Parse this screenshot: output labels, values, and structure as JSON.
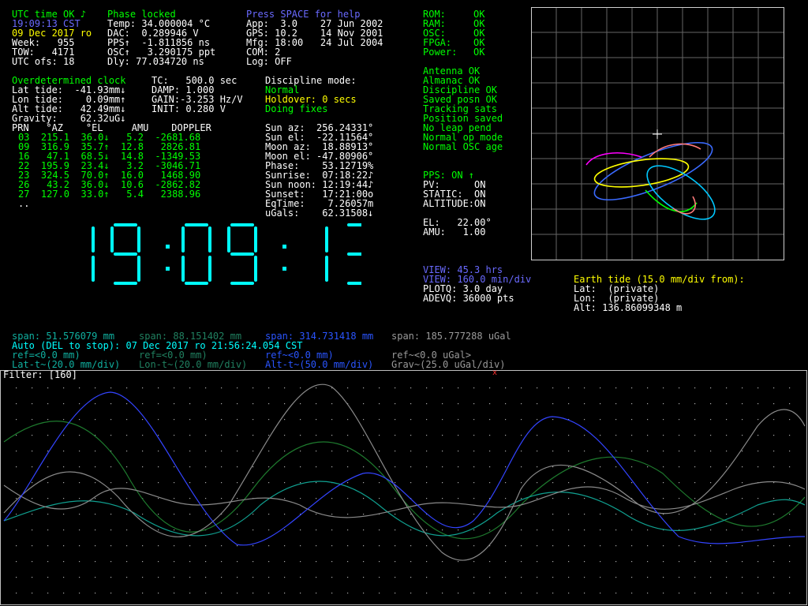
{
  "status": {
    "utc_time_ok": "UTC time OK ♪",
    "phase": "Phase locked",
    "time": "19:09:13 CST",
    "date": "09 Dec 2017 ro",
    "week": "Week:   955",
    "tow": "TOW:   4171",
    "utc_ofs": "UTC ofs: 18"
  },
  "receiver": {
    "temp": "Temp: 34.000004 °C",
    "dac": "DAC:  0.289946 V",
    "pps": "PPS↑  -1.811856 ns",
    "osc": "OSC↑   3.290175 ppt",
    "dly": "Dly: 77.034720 ns"
  },
  "version": {
    "help": "Press SPACE for help",
    "app": "App:  3.0    27 Jun 2002",
    "gps": "GPS: 10.2    14 Nov 2001",
    "mfg": "Mfg: 18:00   24 Jul 2004",
    "com": "COM: 2",
    "log": "Log: OFF"
  },
  "health": [
    {
      "name": "ROM:",
      "value": "OK"
    },
    {
      "name": "RAM:",
      "value": "OK"
    },
    {
      "name": "OSC:",
      "value": "OK"
    },
    {
      "name": "FPGA:",
      "value": "OK"
    },
    {
      "name": "Power:",
      "value": "OK"
    }
  ],
  "clock": {
    "title": "Overdetermined clock",
    "lat_tide": "Lat tide:  -41.93mm↓",
    "lon_tide": "Lon tide:    0.09mm↑",
    "alt_tide": "Alt tide:   42.49mm↓",
    "gravity": "Gravity:    62.32uG↓",
    "tc": "TC:   500.0 sec",
    "damp": "DAMP: 1.000",
    "gain": "GAIN:-3.253 Hz/V",
    "init": "INIT: 0.280 V"
  },
  "discipline": {
    "title": "Discipline mode:",
    "mode": "Normal",
    "holdover": "Holdover: 0 secs",
    "doing": "Doing fixes"
  },
  "status_list": [
    "Antenna OK",
    "Almanac OK",
    "Discipline OK",
    "Saved posn OK",
    "Tracking sats",
    "Position saved",
    "No leap pend",
    "Normal op mode",
    "Normal OSC age"
  ],
  "sats": {
    "header": "PRN   °AZ    °EL     AMU    DOPPLER",
    "rows": [
      "03  215.1  36.0↓   5.2  -2681.68",
      "09  316.9  35.7↑  12.8   2826.81",
      "16   47.1  68.5↓  14.8  -1349.53",
      "22  195.9  23.4↓   3.2  -3046.71",
      "23  324.5  70.0↑  16.0   1468.90",
      "26   43.2  36.0↓  10.6  -2862.82",
      "27  127.0  33.0↑   5.4   2388.96"
    ],
    "more": ".."
  },
  "astro": [
    "Sun az:  256.24331°",
    "Sun el:  -22.11564°",
    "Moon az:  18.88913°",
    "Moon el: -47.80906°",
    "Phase:    53.12719%",
    "Sunrise:  07:18:22♪",
    "Sun noon: 12:19:44♪",
    "Sunset:   17:21:00o",
    "EqTime:    7.26057m",
    "uGals:    62.31508↓"
  ],
  "pps_block": {
    "pps": "PPS: ON ↑",
    "pv": "PV:      ON",
    "static": "STATIC:  ON",
    "altitude": "ALTITUDE:ON",
    "el": "EL:   22.00°",
    "amu": "AMU:   1.00"
  },
  "big_clock": "19:09:13",
  "view": {
    "view_hrs": "VIEW: 45.3 hrs",
    "view_min": "VIEW: 160.0 min/div",
    "plotq": "PLOTQ: 3.0 day",
    "adevq": "ADEVQ: 36000 pts"
  },
  "earth_tide": {
    "title": "Earth tide (15.0 mm/div from):",
    "lat": "Lat:  (private)",
    "lon": "Lon:  (private)",
    "alt": "Alt: 136.86099348 m"
  },
  "graph_header": {
    "span1": "span: 51.576079 mm",
    "span2": "span: 88.151402 mm",
    "span3": "span: 314.731418 mm",
    "span4": "span: 185.777288 uGal",
    "auto": "Auto (DEL to stop): 07 Dec 2017 ro 21:56:24.054 CST",
    "ref1": "ref=<0.0 mm)",
    "ref2": "ref=<0.0 mm)",
    "ref3": "ref~<0.0 mm)",
    "ref4": "ref~<0.0 uGal>",
    "lat_t": "Lat-t~(20.0 mm/div)",
    "lon_t": "Lon-t~(20.0 mm/div)",
    "alt_t": "Alt-t~(50.0 mm/div)",
    "grav": "Grav~(25.0 uGal/div)",
    "filter": "Filter: [160]"
  },
  "colors": {
    "green": "#00ff00",
    "yellow": "#ffff00",
    "cyan": "#00ffff",
    "blue": "#6a6aff",
    "gray": "#9a9a9a",
    "lat_trace": "#10a090",
    "lon_trace": "#1e7a2e",
    "alt_trace": "#3344ff",
    "grav_trace": "#8a8a8a"
  }
}
